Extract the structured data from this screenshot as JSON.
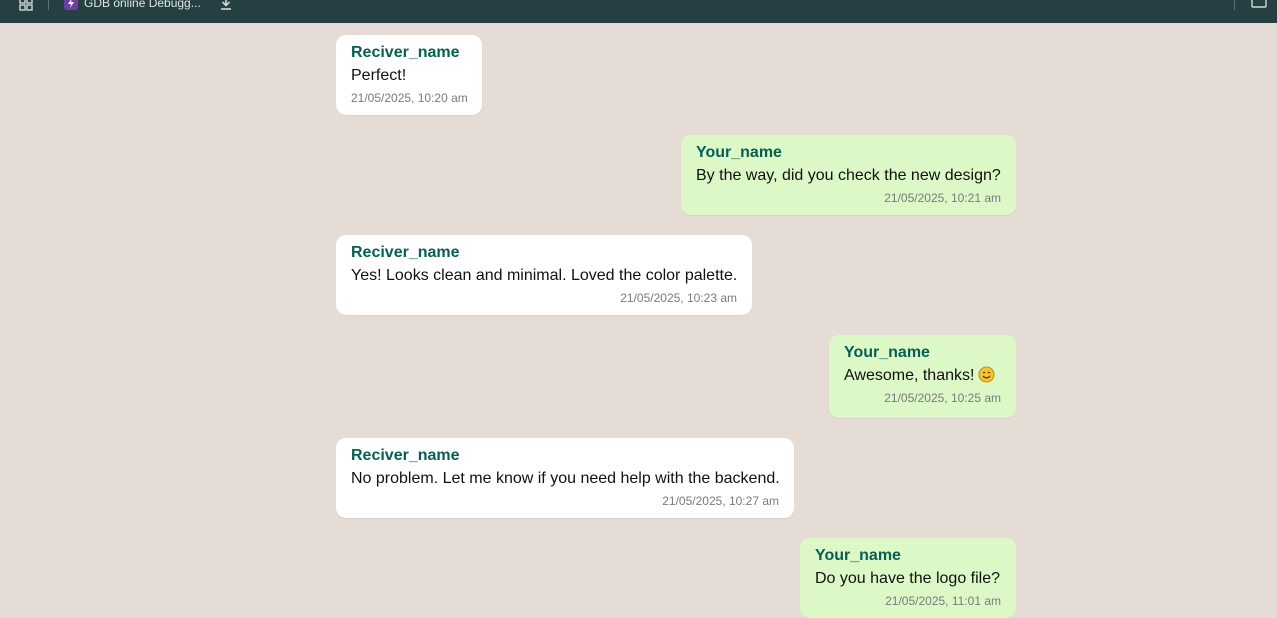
{
  "topbar": {
    "bookmark_label": "GDB online Debugg...",
    "colors": {
      "background": "#263f42",
      "favicon": "#6b3fa0"
    },
    "icons": [
      "apps-grid-icon",
      "lightning-icon",
      "download-icon",
      "window-icon"
    ]
  },
  "colors": {
    "chat_background": "#e5ddd5",
    "received_bubble": "#ffffff",
    "sent_bubble": "#dcf8c6",
    "sender_name": "#075e54",
    "timestamp": "#7a7a7a"
  },
  "messages": [
    {
      "direction": "received",
      "sender": "Reciver_name",
      "text": "Perfect!",
      "time": "21/05/2025, 10:20 am"
    },
    {
      "direction": "sent",
      "sender": "Your_name",
      "text": "By the way, did you check the new design?",
      "time": "21/05/2025, 10:21 am"
    },
    {
      "direction": "received",
      "sender": "Reciver_name",
      "text": "Yes! Looks clean and minimal. Loved the color palette.",
      "time": "21/05/2025, 10:23 am"
    },
    {
      "direction": "sent",
      "sender": "Your_name",
      "text": "Awesome, thanks!",
      "emoji": "smiling-face-emoji",
      "time": "21/05/2025, 10:25 am"
    },
    {
      "direction": "received",
      "sender": "Reciver_name",
      "text": "No problem. Let me know if you need help with the backend.",
      "time": "21/05/2025, 10:27 am"
    },
    {
      "direction": "sent",
      "sender": "Your_name",
      "text": "Do you have the logo file?",
      "time": "21/05/2025, 11:01 am"
    }
  ]
}
